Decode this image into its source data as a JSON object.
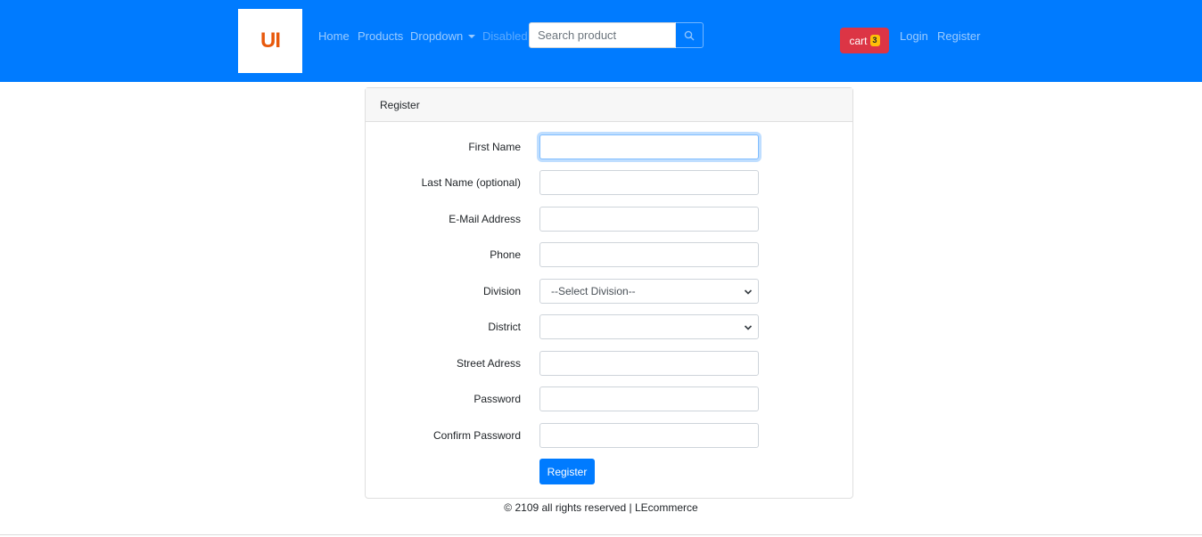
{
  "navbar": {
    "logo_text": "UI",
    "links": {
      "home": "Home",
      "products": "Products",
      "dropdown": "Dropdown",
      "disabled": "Disabled"
    },
    "search": {
      "placeholder": "Search product",
      "value": ""
    },
    "cart": {
      "label": "cart",
      "count": "3"
    },
    "auth": {
      "login": "Login",
      "register": "Register"
    },
    "brand_color": "#007bff"
  },
  "card": {
    "header": "Register",
    "fields": {
      "first_name": {
        "label": "First Name",
        "value": ""
      },
      "last_name": {
        "label": "Last Name (optional)",
        "value": ""
      },
      "email": {
        "label": "E-Mail Address",
        "value": ""
      },
      "phone": {
        "label": "Phone",
        "value": ""
      },
      "division": {
        "label": "Division",
        "selected": "--Select Division--"
      },
      "district": {
        "label": "District",
        "selected": ""
      },
      "street": {
        "label": "Street Adress",
        "value": ""
      },
      "password": {
        "label": "Password",
        "value": ""
      },
      "confirm_password": {
        "label": "Confirm Password",
        "value": ""
      }
    },
    "submit_label": "Register"
  },
  "footer": {
    "text": "© 2109 all rights reserved | LEcommerce"
  },
  "icons": {
    "search": "search-icon",
    "select_chevron": "chevron-down-icon",
    "dropdown_caret": "caret-down-icon"
  },
  "colors": {
    "cart": "#dc3545",
    "badge": "#ffc107",
    "logo_text": "#e8590c",
    "primary_button": "#007bff"
  }
}
